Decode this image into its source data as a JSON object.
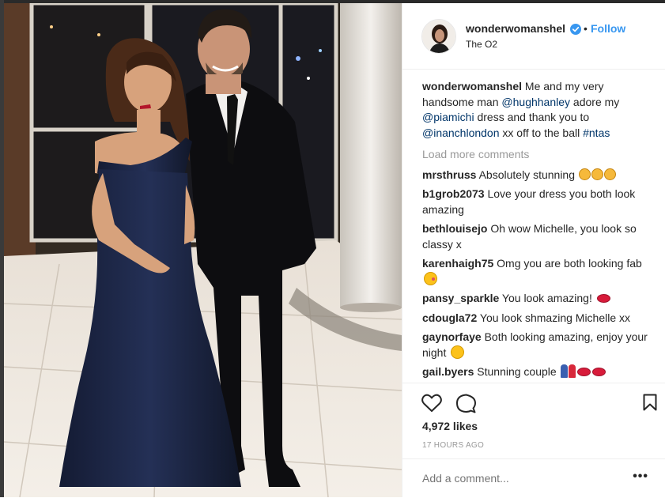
{
  "post": {
    "username": "wonderwomanshel",
    "follow_label": "Follow",
    "separator": "•",
    "location": "The O2",
    "caption": {
      "username": "wonderwomanshel",
      "text_1": " Me and my very handsome man ",
      "mention_1": "@hughhanley",
      "text_2": " adore my ",
      "mention_2": "@piamichi",
      "text_3": " dress and thank you to ",
      "mention_3": "@inanchlondon",
      "text_4": " xx off to the ball ",
      "hashtag": "#ntas"
    },
    "load_more_label": "Load more comments",
    "comments": [
      {
        "username": "mrsthruss",
        "text": " Absolutely stunning "
      },
      {
        "username": "b1grob2073",
        "text": " Love your dress you both look amazing"
      },
      {
        "username": "bethlouisejo",
        "text": " Oh wow Michelle, you look so classy x"
      },
      {
        "username": "karenhaigh75",
        "text": " Omg you are both looking fab "
      },
      {
        "username": "pansy_sparkle",
        "text": " You look amazing! "
      },
      {
        "username": "cdougla72",
        "text": " You look shmazing Michelle xx"
      },
      {
        "username": "gaynorfaye",
        "text": " Both looking amazing, enjoy your night "
      },
      {
        "username": "gail.byers",
        "text": " Stunning couple "
      }
    ],
    "likes": "4,972 likes",
    "time_ago": "17 HOURS AGO",
    "add_comment_placeholder": "Add a comment...",
    "more_options": "•••",
    "icons": {
      "like": "heart-icon",
      "comment": "speech-bubble-icon",
      "save": "bookmark-icon",
      "verified": "verified-badge-icon"
    },
    "colors": {
      "link": "#3897f0",
      "mention": "#003569",
      "muted": "#999999",
      "text": "#262626",
      "dress": "#1a2340"
    }
  }
}
